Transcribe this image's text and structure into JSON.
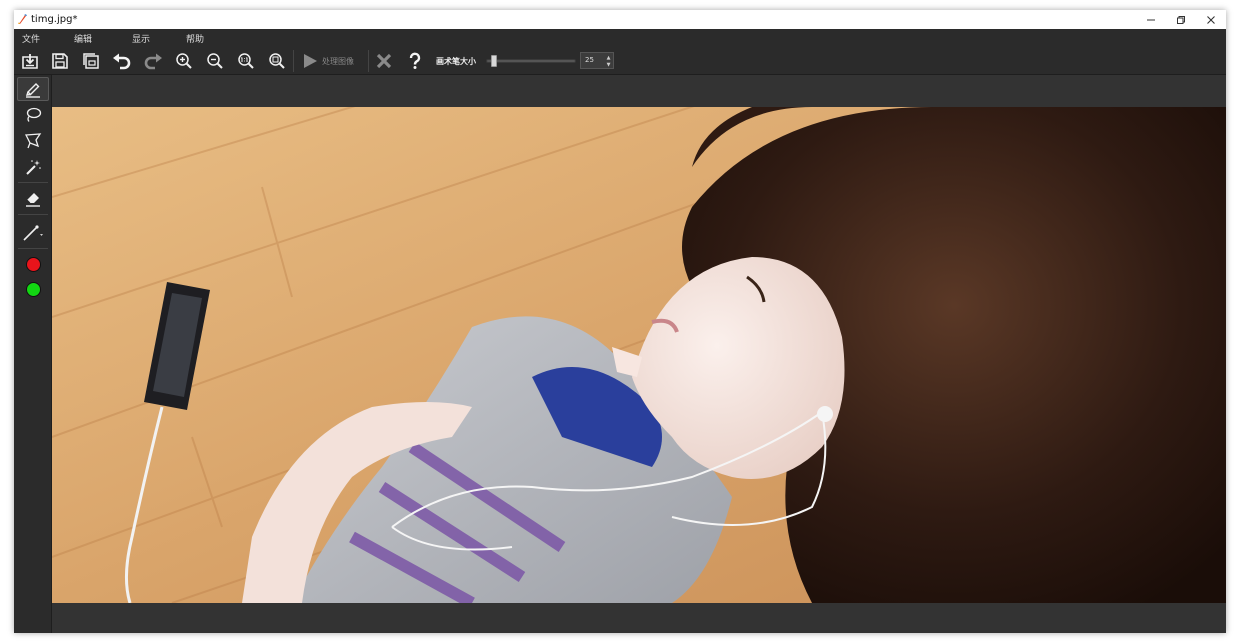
{
  "window": {
    "title": "timg.jpg*"
  },
  "menu": {
    "items": [
      "文件",
      "编辑",
      "显示",
      "帮助"
    ]
  },
  "toolbar": {
    "process_label": "处理图像",
    "brush_size_label": "画术笔大小",
    "brush_size_value": "25",
    "brush_size_fraction": 0.06
  },
  "colors": {
    "foreground_color": "#e8141b",
    "background_color": "#12d612",
    "ui_dark": "#2b2b2b",
    "canvas_bg": "#333333"
  },
  "icons": {
    "toolbar": [
      "open-file-icon",
      "save-icon",
      "save-as-icon",
      "undo-icon",
      "redo-icon",
      "zoom-in-icon",
      "zoom-out-icon",
      "zoom-actual-icon",
      "zoom-fit-icon",
      "play-icon",
      "close-x-icon",
      "help-icon"
    ],
    "left_toolbar": [
      "brush-icon",
      "lasso-icon",
      "polygon-lasso-icon",
      "magic-wand-icon",
      "eraser-icon",
      "line-icon"
    ]
  }
}
